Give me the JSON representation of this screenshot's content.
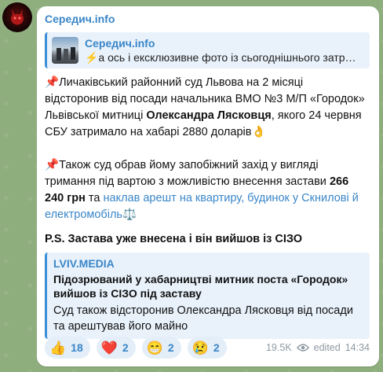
{
  "channel": {
    "name": "Середич.info"
  },
  "forwarded": {
    "title": "Середич.info",
    "snippet": "⚡️а ось і ексклюзивне фото із сьогоднішнього затри…"
  },
  "message": {
    "p1_emoji": "📌",
    "p1_a": "Личаківський районний суд Львова на 2 місяці відсторонив від посади начальника ВМО №3 М/П «Городок» Львівської митниці ",
    "p1_bold": "Олександра Лясковця",
    "p1_b": ", якого 24 червня СБУ затримало на хабарі 2880 доларів",
    "p1_end_emoji": "👌",
    "p2_emoji": "📌",
    "p2_a": "Також суд обрав йому запобіжний захід у вигляді тримання під вартою з можливістю внесення застави ",
    "p2_bold": "266 240 грн",
    "p2_b": " та ",
    "p2_link": "наклав арешт на квартиру, будинок у Скнилові й електромобіль",
    "p2_end_emoji": "⚖️",
    "ps": "P.S. Застава уже внесена і він вийшов із СІЗО"
  },
  "link_preview": {
    "site": "LVIV.MEDIA",
    "title": "Підозрюваний у хабарництві митник поста «Городок» вийшов із СІЗО під заставу",
    "description": "Суд також відсторонив Олександра Лясковця від посади та арештував його майно"
  },
  "reactions": [
    {
      "emoji": "👍",
      "count": "18"
    },
    {
      "emoji": "❤️",
      "count": "2"
    },
    {
      "emoji": "😁",
      "count": "2"
    },
    {
      "emoji": "😢",
      "count": "2"
    }
  ],
  "meta": {
    "views": "19.5K",
    "status": "edited",
    "time": "14:34"
  },
  "colors": {
    "accent": "#3a86c8",
    "bubble": "#ffffff",
    "background": "#8fae7e"
  }
}
